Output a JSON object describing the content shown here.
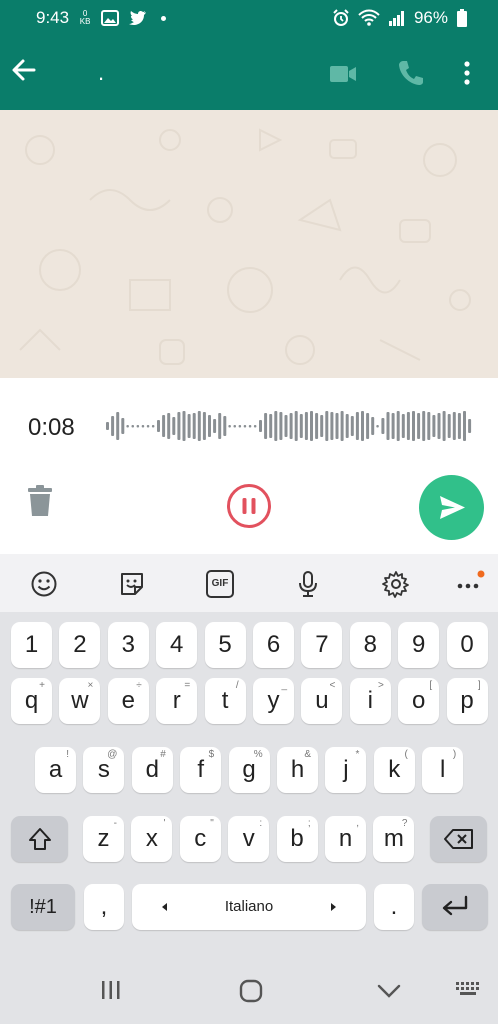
{
  "status": {
    "time": "9:43",
    "kb_top": "0",
    "kb_bottom": "KB",
    "battery": "96%"
  },
  "appbar": {
    "title": "."
  },
  "recorder": {
    "timer": "0:08"
  },
  "icons": [
    "back-arrow-icon",
    "video-call-icon",
    "phone-icon",
    "more-vert-icon",
    "trash-icon",
    "pause-icon",
    "send-icon",
    "emoji-icon",
    "sticker-icon",
    "gif-icon",
    "mic-icon",
    "settings-icon",
    "more-horiz-icon",
    "shift-icon",
    "backspace-icon",
    "enter-icon",
    "left-arrow-icon",
    "right-arrow-icon"
  ],
  "colors": {
    "header": "#0a7d6a",
    "accent_send": "#31c08a",
    "pause_red": "#e2515e",
    "chat_bg": "#eee6dd"
  },
  "keyboard": {
    "gif_label": "GIF",
    "row1": [
      {
        "k": "1"
      },
      {
        "k": "2"
      },
      {
        "k": "3"
      },
      {
        "k": "4"
      },
      {
        "k": "5"
      },
      {
        "k": "6"
      },
      {
        "k": "7"
      },
      {
        "k": "8"
      },
      {
        "k": "9"
      },
      {
        "k": "0"
      }
    ],
    "row2": [
      {
        "k": "q",
        "s": "+"
      },
      {
        "k": "w",
        "s": "×"
      },
      {
        "k": "e",
        "s": "÷"
      },
      {
        "k": "r",
        "s": "="
      },
      {
        "k": "t",
        "s": "/"
      },
      {
        "k": "y",
        "s": "_"
      },
      {
        "k": "u",
        "s": "<"
      },
      {
        "k": "i",
        "s": ">"
      },
      {
        "k": "o",
        "s": "["
      },
      {
        "k": "p",
        "s": "]"
      }
    ],
    "row3": [
      {
        "k": "a",
        "s": "!"
      },
      {
        "k": "s",
        "s": "@"
      },
      {
        "k": "d",
        "s": "#"
      },
      {
        "k": "f",
        "s": "$"
      },
      {
        "k": "g",
        "s": "%"
      },
      {
        "k": "h",
        "s": "&"
      },
      {
        "k": "j",
        "s": "*"
      },
      {
        "k": "k",
        "s": "("
      },
      {
        "k": "l",
        "s": ")"
      }
    ],
    "row4": [
      {
        "k": "z",
        "s": "-"
      },
      {
        "k": "x",
        "s": "'"
      },
      {
        "k": "c",
        "s": "\""
      },
      {
        "k": "v",
        "s": ":"
      },
      {
        "k": "b",
        "s": ";"
      },
      {
        "k": "n",
        "s": ","
      },
      {
        "k": "m",
        "s": "?"
      }
    ],
    "symbols_label": "!#1",
    "comma_label": ",",
    "space_label": "Italiano",
    "period_label": "."
  }
}
